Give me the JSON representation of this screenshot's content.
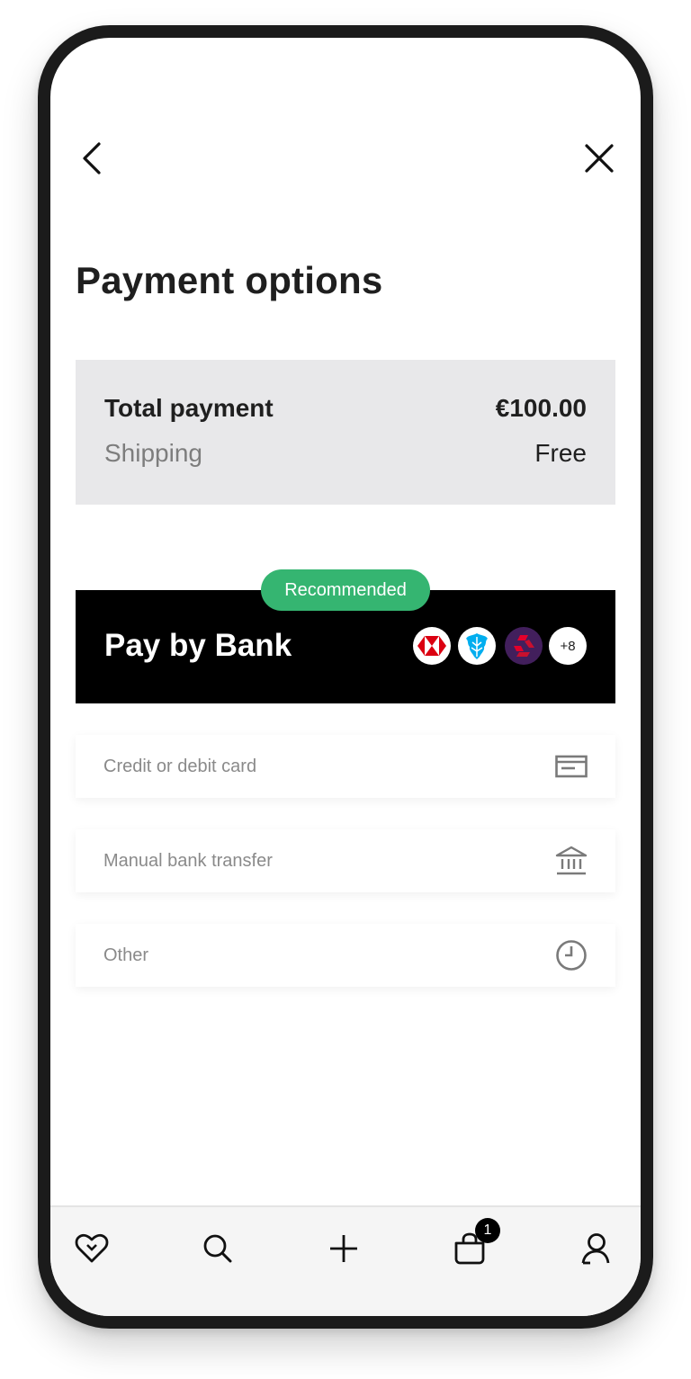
{
  "header": {
    "back_icon": "chevron-left-icon",
    "close_icon": "close-icon",
    "title": "Payment options"
  },
  "summary": {
    "total_label": "Total payment",
    "total_value": "€100.00",
    "shipping_label": "Shipping",
    "shipping_value": "Free"
  },
  "pay_by_bank": {
    "badge": "Recommended",
    "label": "Pay by Bank",
    "banks": [
      "hsbc-logo",
      "barclays-logo",
      "natwest-logo"
    ],
    "more_banks": "+8"
  },
  "options": [
    {
      "label": "Credit or debit card",
      "icon": "credit-card-icon"
    },
    {
      "label": "Manual bank transfer",
      "icon": "bank-icon"
    },
    {
      "label": "Other",
      "icon": "clock-icon"
    }
  ],
  "bottom_nav": {
    "items": [
      "heart-icon",
      "search-icon",
      "plus-icon",
      "shopping-bag-icon",
      "profile-icon"
    ],
    "cart_count": "1"
  },
  "colors": {
    "accent_green": "#35b571",
    "summary_bg": "#e8e8ea",
    "pay_by_bank_bg": "#000000",
    "hsbc_red": "#db0011",
    "barclays_blue": "#00aeef",
    "natwest_purple": "#421f5c"
  }
}
